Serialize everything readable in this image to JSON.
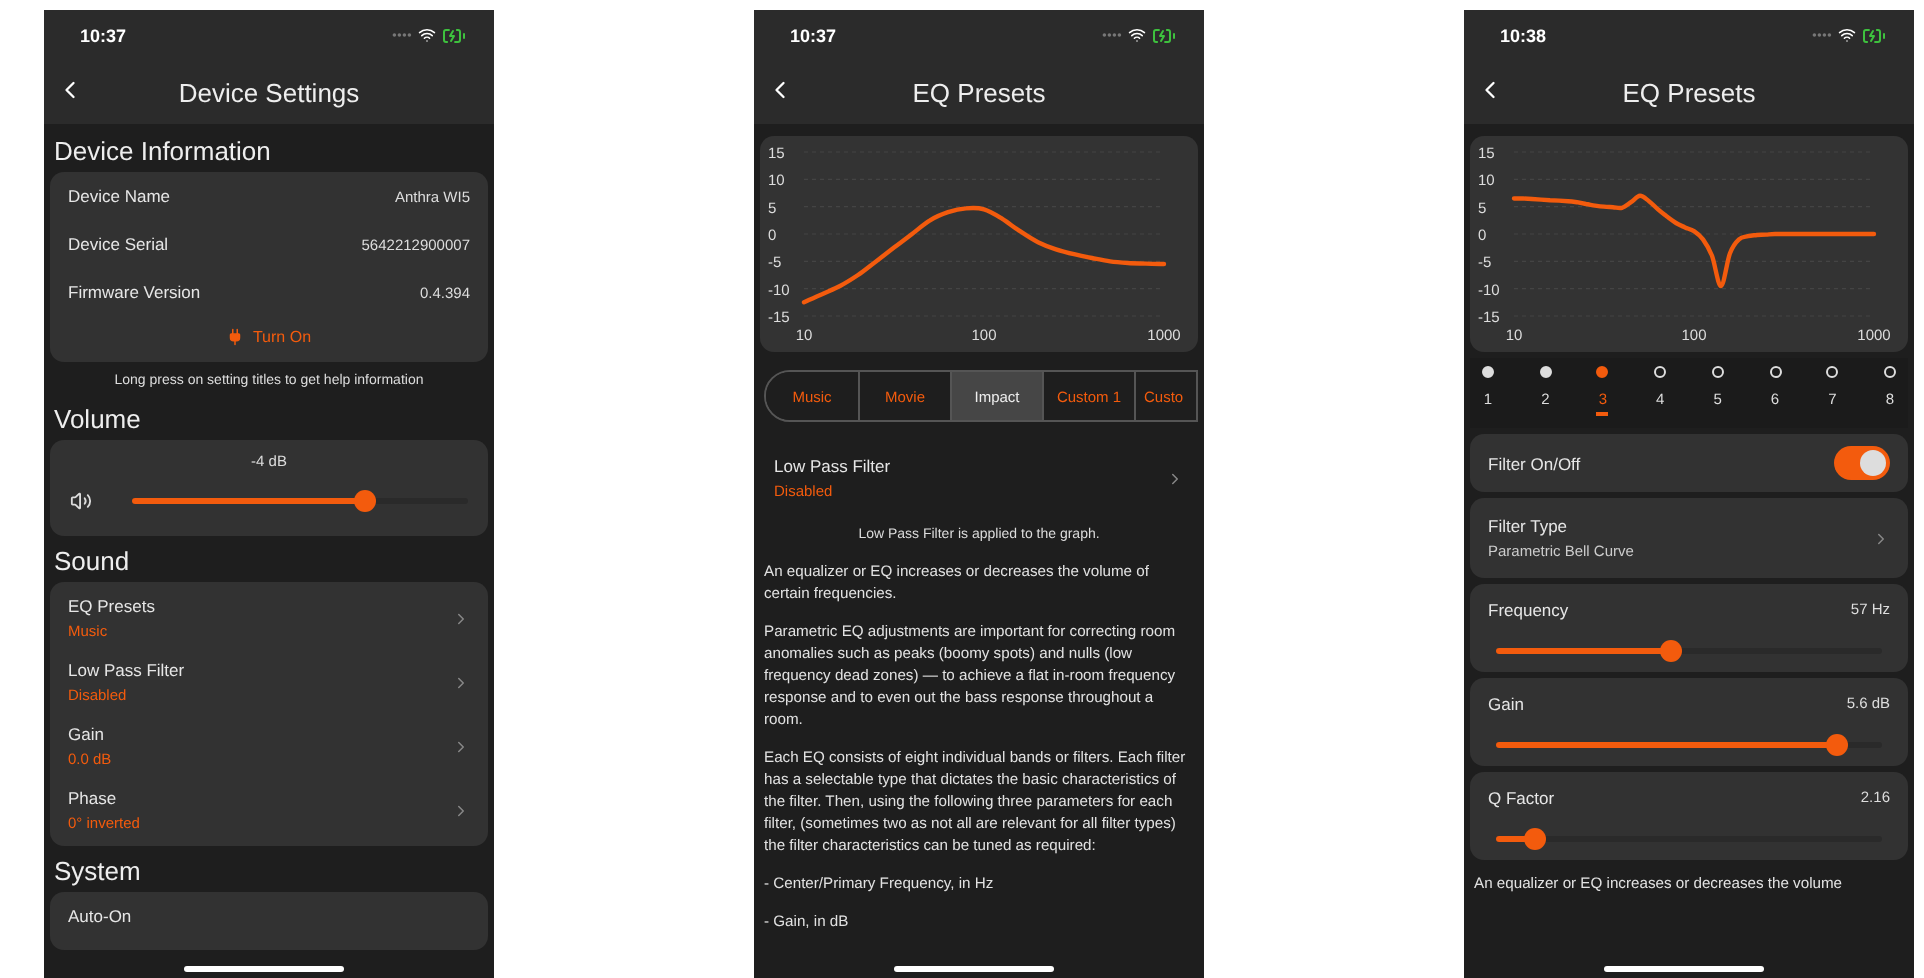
{
  "phones": [
    {
      "time": "10:37",
      "title": "Device Settings",
      "blocks": [
        {
          "kind": "info",
          "title": "Device Information",
          "rows": [
            {
              "label": "Device Name",
              "value": "Anthra WI5"
            },
            {
              "label": "Device Serial",
              "value": "5642212900007"
            },
            {
              "label": "Firmware Version",
              "value": "0.4.394"
            }
          ],
          "action": "Turn On"
        },
        {
          "kind": "note",
          "text": "Long press on setting titles to get help information"
        },
        {
          "kind": "volume",
          "title": "Volume",
          "reading": "-4 dB",
          "level": 0.69
        },
        {
          "kind": "menu",
          "title": "Sound",
          "rows": [
            {
              "title": "EQ Presets",
              "value": "Music"
            },
            {
              "title": "Low Pass Filter",
              "value": "Disabled"
            },
            {
              "title": "Gain",
              "value": "0.0 dB"
            },
            {
              "title": "Phase",
              "value": "0°  inverted"
            }
          ]
        },
        {
          "kind": "menu",
          "title": "System",
          "rows": [
            {
              "title": "Auto-On"
            }
          ]
        }
      ]
    },
    {
      "time": "10:37",
      "title": "EQ Presets",
      "blocks": [
        {
          "kind": "chart",
          "chart_data": {
            "type": "line",
            "categories": [
              "10",
              null,
              null,
              null,
              null,
              null,
              null,
              null,
              null,
              null,
              "100",
              null,
              null,
              null,
              null,
              null,
              null,
              null,
              null,
              null,
              "1000"
            ],
            "series": [
              {
                "color": "#f35b0d",
                "values": [
                  -12.5,
                  -11,
                  -9.5,
                  -7.5,
                  -5,
                  -2.5,
                  0,
                  2.5,
                  4,
                  4.7,
                  4.5,
                  2.8,
                  0.5,
                  -1.5,
                  -2.8,
                  -3.7,
                  -4.4,
                  -5,
                  -5.3,
                  -5.4,
                  -5.5
                ]
              }
            ],
            "grid": true,
            "ylim": [
              -15,
              15
            ],
            "yticks": [
              15,
              10,
              5,
              0,
              -5,
              -10,
              -15
            ]
          }
        },
        {
          "kind": "segments",
          "tabs": [
            {
              "label": "Music",
              "selected": false
            },
            {
              "label": "Movie",
              "selected": false
            },
            {
              "label": "Impact",
              "selected": true
            },
            {
              "label": "Custom 1",
              "selected": false
            },
            {
              "label": "Custo",
              "selected": false
            }
          ]
        },
        {
          "kind": "row",
          "title": "Low Pass Filter",
          "value": "Disabled"
        },
        {
          "kind": "note",
          "text": "Low Pass Filter is applied to the graph."
        },
        {
          "kind": "paragraphs",
          "items": [
            "An equalizer or EQ increases or decreases the volume of certain frequencies.",
            "Parametric EQ adjustments are important for correcting room anomalies such as peaks (boomy spots) and nulls (low frequency dead zones) — to achieve a flat in-room frequency response and to even out the bass response throughout a room.",
            "Each EQ consists of eight individual bands or filters. Each filter has a selectable type that dictates the basic characteristics of the filter.  Then, using the following three parameters for each filter, (sometimes two as not all are relevant for all filter types) the filter characteristics can be tuned as required:",
            "- Center/Primary Frequency, in Hz",
            "- Gain, in dB"
          ]
        }
      ]
    },
    {
      "time": "10:38",
      "title": "EQ Presets",
      "blocks": [
        {
          "kind": "chart",
          "chart_data": {
            "type": "line",
            "categories": [
              "10",
              null,
              null,
              null,
              null,
              null,
              null,
              null,
              null,
              null,
              null,
              null,
              null,
              null,
              null,
              null,
              null,
              null,
              null,
              null,
              "100",
              null,
              null,
              null,
              null,
              null,
              null,
              null,
              null,
              null,
              null,
              null,
              null,
              null,
              null,
              null,
              null,
              null,
              null,
              null,
              "1000"
            ],
            "series": [
              {
                "color": "#f35b0d",
                "values": [
                  6.5,
                  6.5,
                  6.4,
                  6.3,
                  6.2,
                  6.1,
                  6,
                  5.8,
                  5.5,
                  5.2,
                  5,
                  4.9,
                  4.8,
                  5.8,
                  7,
                  6,
                  4.5,
                  3.2,
                  2,
                  1.2,
                  0.5,
                  -1,
                  -4,
                  -9.5,
                  -3.5,
                  -1,
                  -0.4,
                  -0.2,
                  -0.1,
                  0,
                  0,
                  0,
                  0,
                  0,
                  0,
                  0,
                  0,
                  0,
                  0,
                  0,
                  0
                ]
              }
            ],
            "grid": true,
            "ylim": [
              -15,
              15
            ],
            "yticks": [
              15,
              10,
              5,
              0,
              -5,
              -10,
              -15
            ]
          }
        },
        {
          "kind": "bands",
          "bands": [
            {
              "label": "1",
              "on": true,
              "selected": false
            },
            {
              "label": "2",
              "on": true,
              "selected": false
            },
            {
              "label": "3",
              "on": true,
              "selected": true
            },
            {
              "label": "4",
              "on": false,
              "selected": false
            },
            {
              "label": "5",
              "on": false,
              "selected": false
            },
            {
              "label": "6",
              "on": false,
              "selected": false
            },
            {
              "label": "7",
              "on": false,
              "selected": false
            },
            {
              "label": "8",
              "on": false,
              "selected": false
            }
          ]
        },
        {
          "kind": "toggle",
          "title": "Filter On/Off",
          "on": true
        },
        {
          "kind": "panel_row",
          "title": "Filter Type",
          "value": "Parametric Bell Curve"
        },
        {
          "kind": "slider",
          "title": "Frequency",
          "reading": "57 Hz",
          "level": 0.45
        },
        {
          "kind": "slider",
          "title": "Gain",
          "reading": "5.6 dB",
          "level": 0.88
        },
        {
          "kind": "slider",
          "title": "Q Factor",
          "reading": "2.16",
          "level": 0.1
        },
        {
          "kind": "paragraphs",
          "items": [
            "An equalizer or EQ increases or decreases the volume"
          ]
        }
      ]
    }
  ]
}
